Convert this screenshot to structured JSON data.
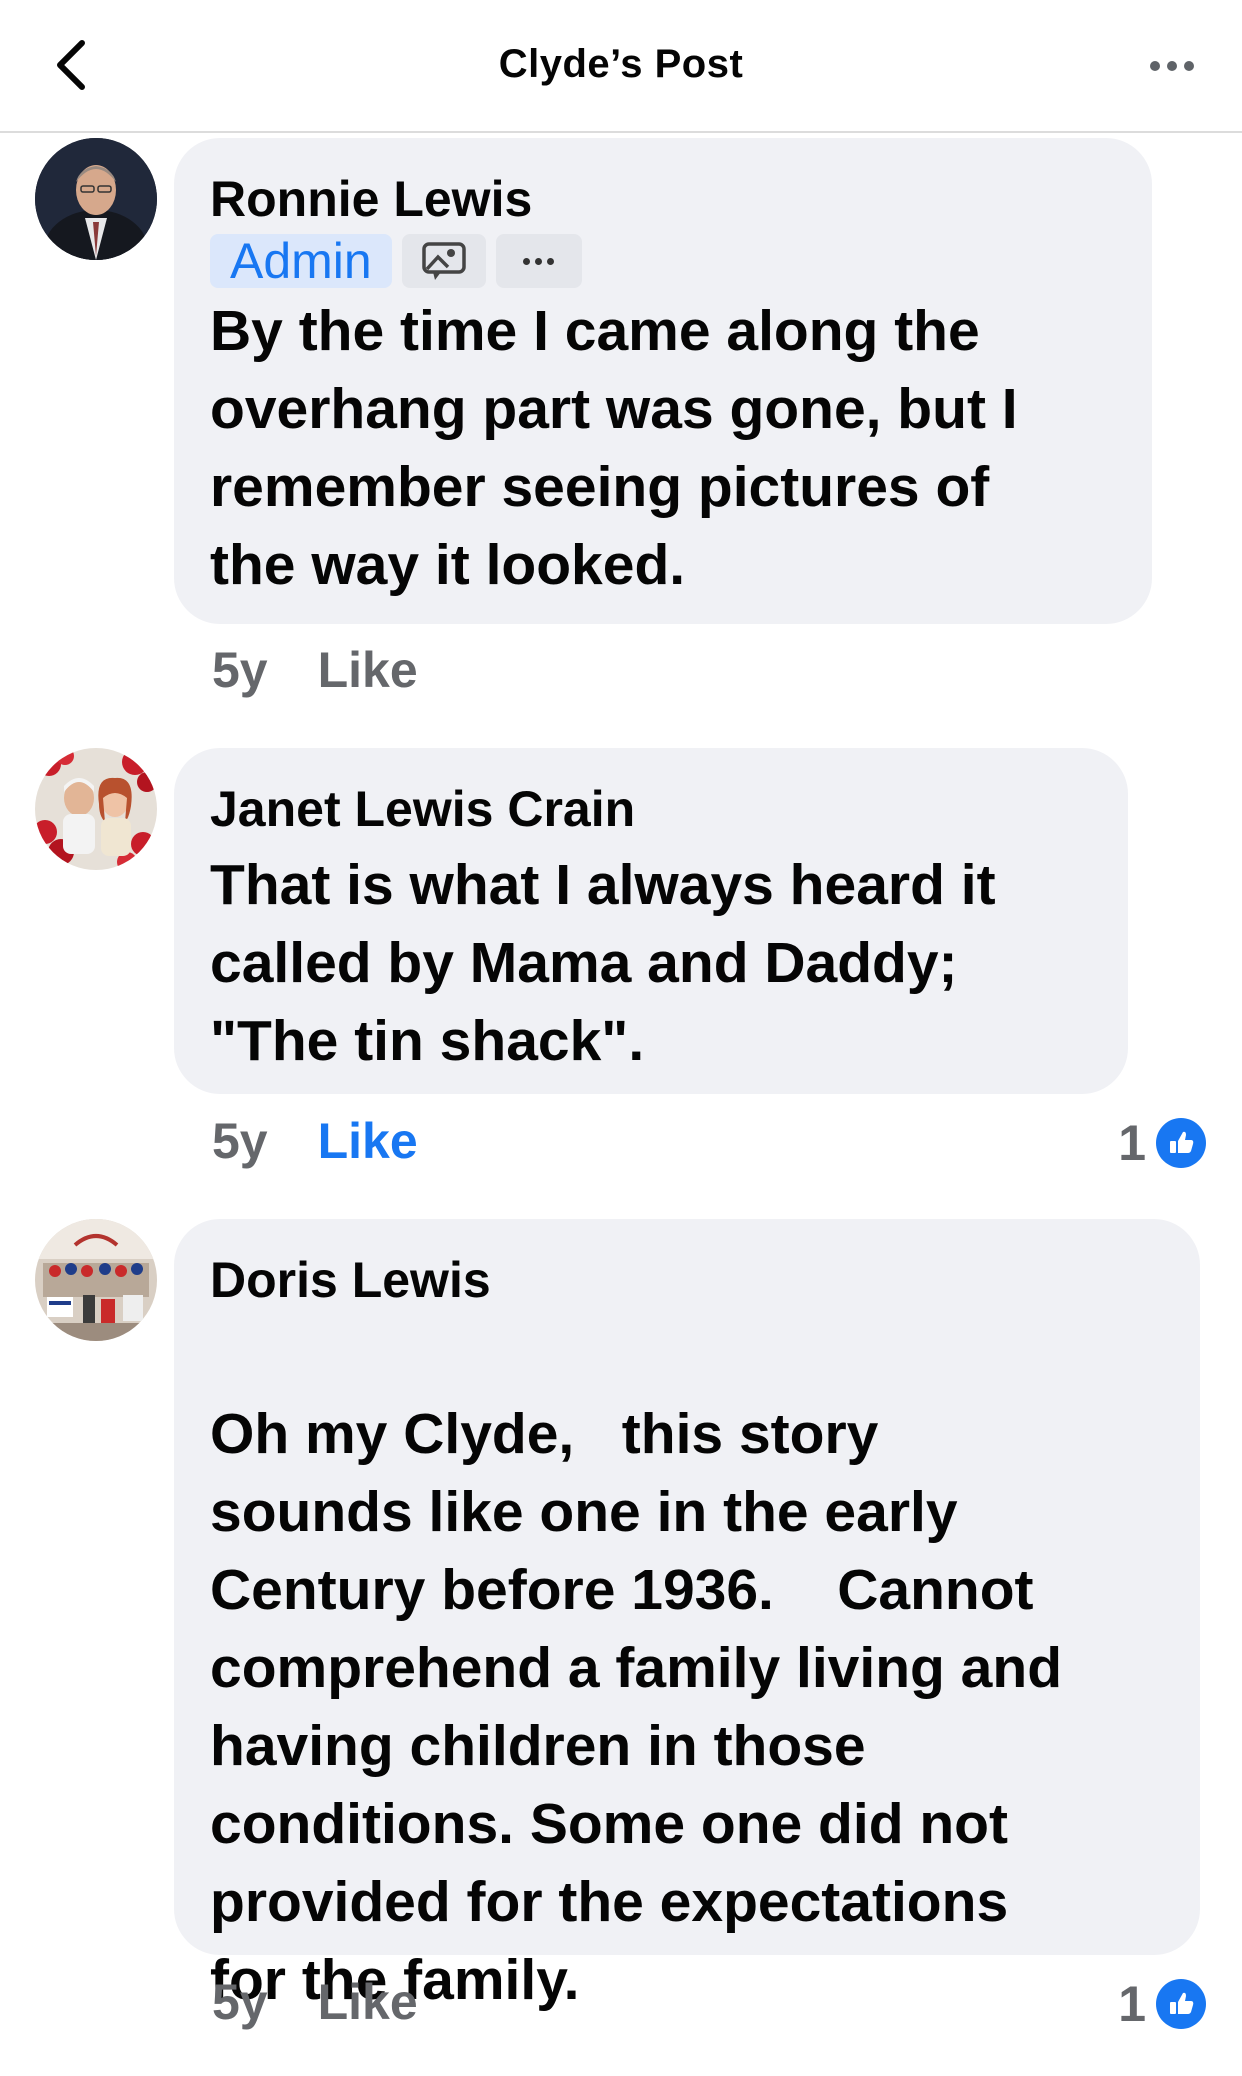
{
  "header": {
    "title": "Clyde’s Post"
  },
  "comments": [
    {
      "author": "Ronnie Lewis",
      "badge": "Admin",
      "lines": [
        "By the time I came along the",
        "overhang part was gone, but I",
        "remember seeing pictures of",
        "the way it looked."
      ],
      "time": "5y",
      "like_label": "Like",
      "liked": false
    },
    {
      "author": "Janet Lewis Crain",
      "lines": [
        "That is what I always heard it",
        "called by Mama and Daddy;",
        "\"The tin shack\"."
      ],
      "time": "5y",
      "like_label": "Like",
      "liked": true,
      "reaction_count": "1"
    },
    {
      "author": "Doris Lewis",
      "lines": [
        "Oh my Clyde,   this story",
        "sounds like one in the early",
        "Century before 1936.    Cannot",
        "comprehend a family living and",
        "having children in those",
        "conditions. Some one did not",
        "provided for the expectations",
        "for the family."
      ],
      "time": "5y",
      "like_label": "Like",
      "liked": false,
      "reaction_count": "1"
    }
  ],
  "colors": {
    "accent": "#1877f2",
    "bubble": "#f0f1f5",
    "meta_text": "#65676b"
  }
}
